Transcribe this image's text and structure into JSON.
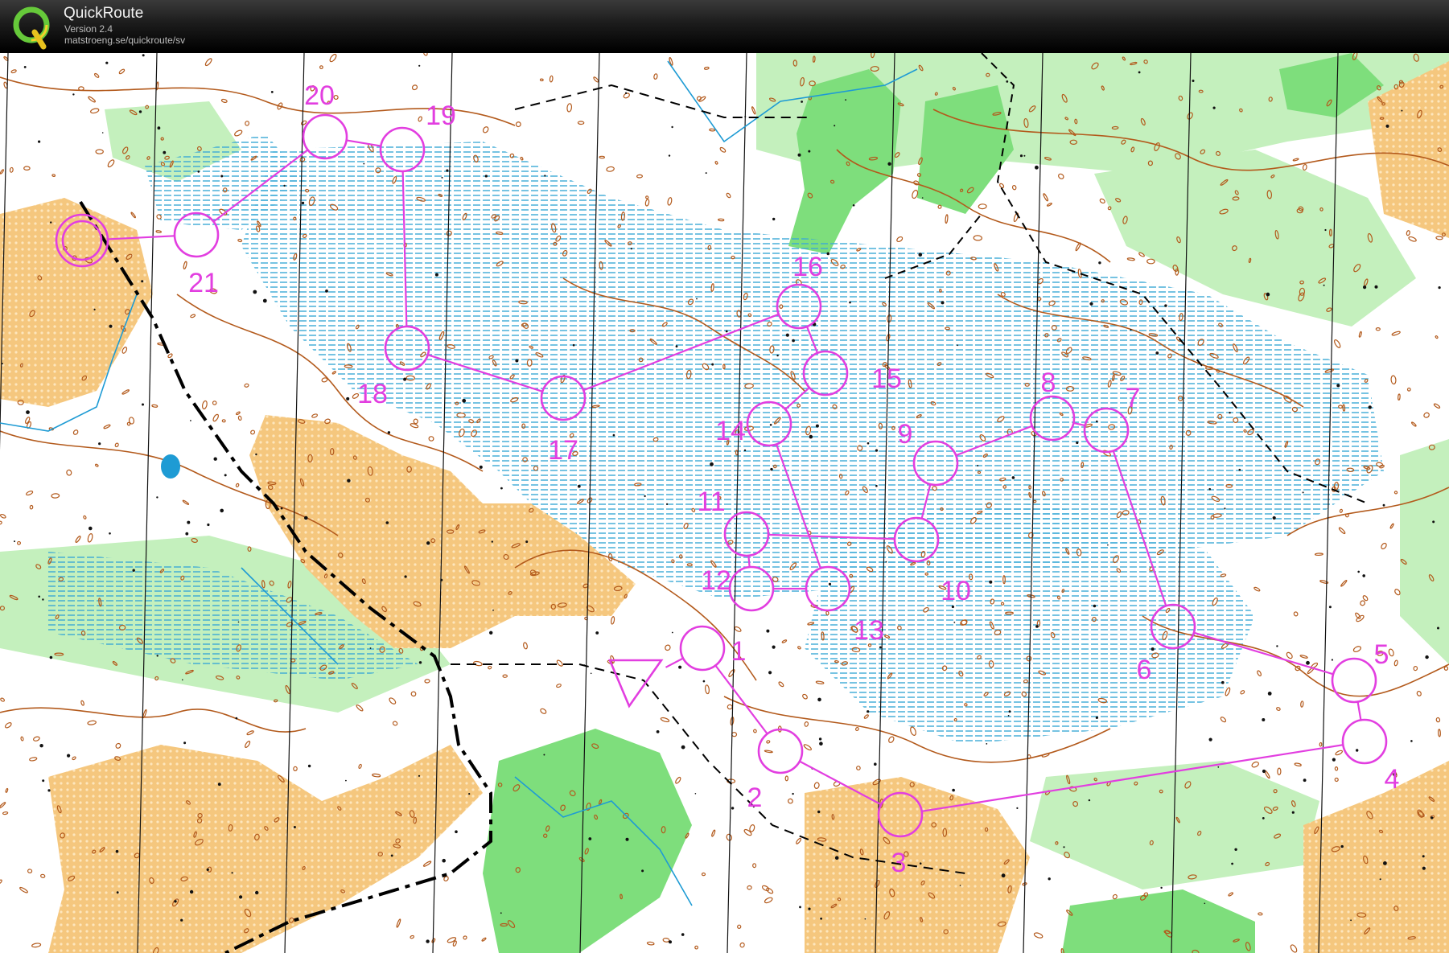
{
  "header": {
    "app_title": "QuickRoute",
    "version": "Version 2.4",
    "url": "matstroeng.se/quickroute/sv",
    "logo_icon": "quickroute-q-logo-icon"
  },
  "colors": {
    "course": "#e23ee0",
    "paper": "#ffffff",
    "forest_green": "#7ede7c",
    "light_green": "#c4f0bd",
    "open_land": "#f5c77e",
    "contour": "#b35a1c",
    "water": "#1e9bd4",
    "marsh": "#3aa9d6",
    "track": "#000000"
  },
  "course": {
    "start_label": "",
    "finish_label": "",
    "controls": [
      {
        "n": "1",
        "label": "1"
      },
      {
        "n": "2",
        "label": "2"
      },
      {
        "n": "3",
        "label": "3"
      },
      {
        "n": "4",
        "label": "4"
      },
      {
        "n": "5",
        "label": "5"
      },
      {
        "n": "6",
        "label": "6"
      },
      {
        "n": "7",
        "label": "7"
      },
      {
        "n": "8",
        "label": "8"
      },
      {
        "n": "9",
        "label": "9"
      },
      {
        "n": "10",
        "label": "10"
      },
      {
        "n": "11",
        "label": "11"
      },
      {
        "n": "12",
        "label": "12"
      },
      {
        "n": "13",
        "label": "13"
      },
      {
        "n": "14",
        "label": "14"
      },
      {
        "n": "15",
        "label": "15"
      },
      {
        "n": "16",
        "label": "16"
      },
      {
        "n": "17",
        "label": "17"
      },
      {
        "n": "18",
        "label": "18"
      },
      {
        "n": "19",
        "label": "19"
      },
      {
        "n": "20",
        "label": "20"
      },
      {
        "n": "21",
        "label": "21"
      }
    ]
  }
}
